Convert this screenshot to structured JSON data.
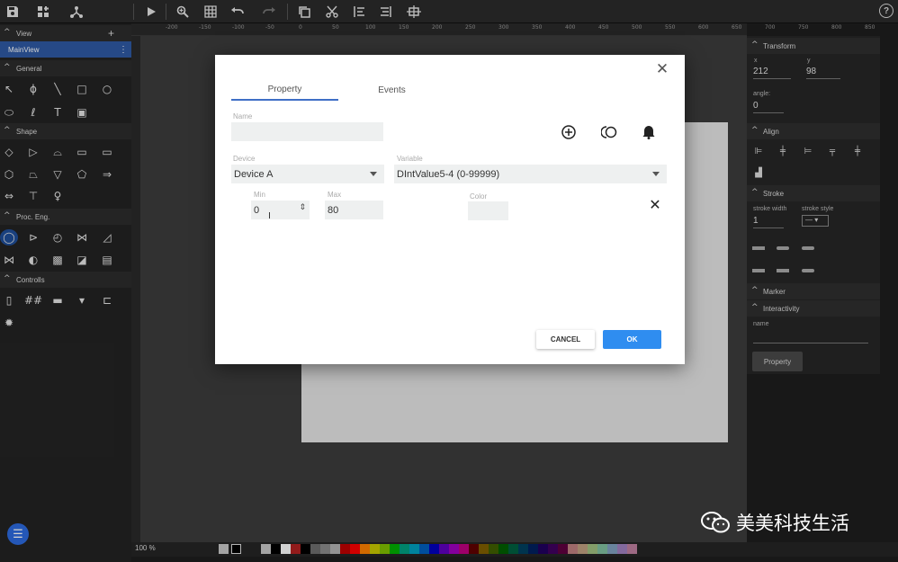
{
  "toolbar": {
    "icons": [
      "save-icon",
      "add-layout-icon",
      "tree-icon",
      "play-icon",
      "zoom-icon",
      "grid-icon",
      "undo-icon",
      "redo-icon",
      "copy-icon",
      "cut-icon",
      "align-left-icon",
      "align-right-icon",
      "group-icon",
      "help-icon"
    ]
  },
  "sidebar": {
    "view_label": "View",
    "view_add": "+",
    "main_view": "MainView",
    "main_view_menu": "⋮",
    "general_label": "General",
    "shape_label": "Shape",
    "proc_label": "Proc. Eng.",
    "controls_label": "Controlls"
  },
  "ruler": {
    "ticks": [
      "-200",
      "-150",
      "-100",
      "-50",
      "0",
      "50",
      "100",
      "150",
      "200",
      "250",
      "300",
      "350",
      "400",
      "450",
      "500",
      "550",
      "600",
      "650",
      "700",
      "750",
      "800",
      "850"
    ]
  },
  "right_panel": {
    "transform_label": "Transform",
    "x_label": "x",
    "x_value": "212",
    "y_label": "y",
    "y_value": "98",
    "angle_label": "angle:",
    "angle_value": "0",
    "align_label": "Align",
    "stroke_label": "Stroke",
    "stroke_width_label": "stroke width",
    "stroke_width_value": "1",
    "stroke_style_label": "stroke style",
    "stroke_style_value": "—",
    "marker_label": "Marker",
    "interactivity_label": "Interactivity",
    "name_label": "name",
    "property_button": "Property"
  },
  "status": {
    "zoom": "100 %"
  },
  "palette": [
    "#c8c8c8",
    "#000000",
    "#ffffff",
    "#b22222",
    "#000000",
    "#6e6e6e",
    "#8c8c8c",
    "#b4b4b4",
    "#c00000",
    "#ff0000",
    "#ff8000",
    "#c8c800",
    "#80c000",
    "#00b000",
    "#00a080",
    "#00a0c0",
    "#0060c0",
    "#0000c0",
    "#6000c0",
    "#a000c0",
    "#c00080",
    "#600000",
    "#806000",
    "#406000",
    "#006000",
    "#006040",
    "#004060",
    "#002060",
    "#200060",
    "#400060",
    "#600040",
    "#c08080",
    "#c0a080",
    "#a0c080",
    "#80c0a0",
    "#80a0c0",
    "#a080c0",
    "#c080a0"
  ],
  "dialog": {
    "tabs": [
      "Property",
      "Events"
    ],
    "name_label": "Name",
    "name_value": "",
    "device_label": "Device",
    "device_value": "Device A",
    "variable_label": "Variable",
    "variable_value": "DIntValue5-4 (0-99999)",
    "min_label": "Min",
    "min_value": "0",
    "max_label": "Max",
    "max_value": "80",
    "color_label": "Color",
    "cancel_label": "CANCEL",
    "ok_label": "OK",
    "close_glyph": "✕"
  },
  "watermark": {
    "text": "美美科技生活"
  }
}
